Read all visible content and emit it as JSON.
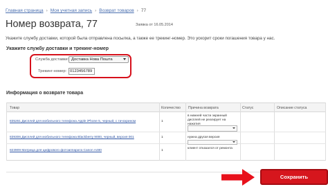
{
  "breadcrumb": {
    "items": [
      "Главная страница",
      "Моя учетная запись",
      "Возврат товаров"
    ],
    "separator": "›",
    "current": "77"
  },
  "page": {
    "title": "Номер возврата, 77",
    "date": "Заявка от 16.05.2014",
    "instruction": "Укажите службу доставки, которой была отправлена посылка, а также ее трекинг-номер. Это ускорит сроки погашения товара у нас."
  },
  "delivery": {
    "section_title": "Укажите службу доставки и трекинг-номер",
    "service_label": "Служба доставки:",
    "service_value": "Доставка Нова Пошта",
    "tracking_label": "Трекинг-номер:",
    "tracking_value": "0123456789"
  },
  "returns": {
    "section_title": "Информация о возврате товара",
    "columns": [
      "Товар",
      "Количество",
      "Причина возврата",
      "Статус",
      "Описание статуса"
    ],
    "rows": [
      {
        "product": "835261 Дисплей для мобильного телефона Apple iPhone 5, черный, с тачскрином",
        "quantity": "1",
        "reason": "в нижней части экранный дисплей не реагирует на нажатия"
      },
      {
        "product": "839306 Дисплей для мобильного телефона Blackberry 9000, черный, версия 001",
        "quantity": "1",
        "reason": "нужна другая версия"
      },
      {
        "product": "823909 Матрица для цифрового фотоаппарата Canon A480",
        "quantity": "1",
        "reason": "клиент отказался от ремонта"
      }
    ]
  },
  "actions": {
    "save_label": "Сохранить"
  },
  "colors": {
    "accent": "#d6161d",
    "link": "#2f55a4"
  },
  "icons": {
    "arrow": "red-right-arrow-icon",
    "select": "chevron-down-icon"
  }
}
